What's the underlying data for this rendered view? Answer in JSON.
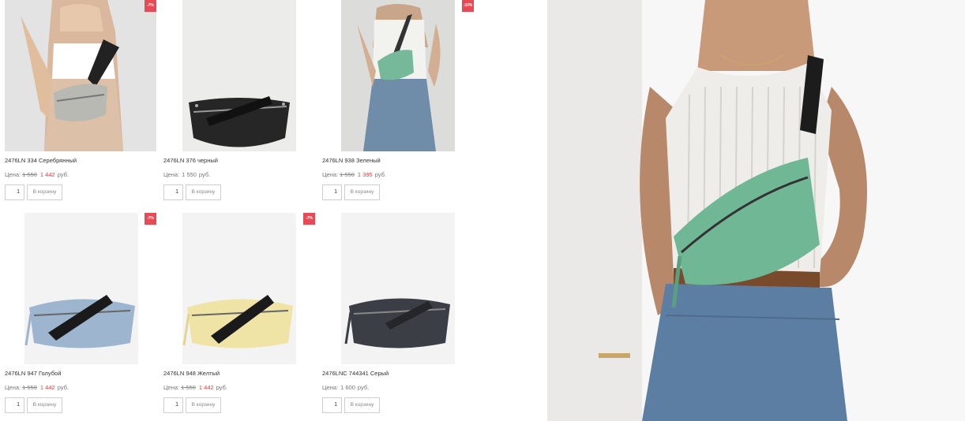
{
  "products": [
    {
      "name": "2476LN 334 Серебрянный",
      "price_label": "Цена:",
      "old_price": "1 550",
      "new_price": "1 442",
      "currency": "руб.",
      "badge": "-7%",
      "qty": "1",
      "cart_label": "В корзину"
    },
    {
      "name": "2476LN 376 черный",
      "price_label": "Цена:",
      "old_price": "",
      "new_price": "1 550",
      "currency": "руб.",
      "badge": "",
      "qty": "1",
      "cart_label": "В корзину"
    },
    {
      "name": "2476LN 938 Зеленый",
      "price_label": "Цена:",
      "old_price": "1 550",
      "new_price": "1 395",
      "currency": "руб.",
      "badge": "-10%",
      "qty": "1",
      "cart_label": "В корзину"
    },
    {
      "name": "2476LN 947 Голубой",
      "price_label": "Цена:",
      "old_price": "1 550",
      "new_price": "1 442",
      "currency": "руб.",
      "badge": "-7%",
      "qty": "1",
      "cart_label": "В корзину"
    },
    {
      "name": "2476LN 948 Желтый",
      "price_label": "Цена:",
      "old_price": "1 550",
      "new_price": "1 442",
      "currency": "руб.",
      "badge": "-7%",
      "qty": "1",
      "cart_label": "В корзину"
    },
    {
      "name": "2476LNC 744341 Серый",
      "price_label": "Цена:",
      "old_price": "",
      "new_price": "1 600",
      "currency": "руб.",
      "badge": "",
      "qty": "1",
      "cart_label": "В корзину"
    }
  ],
  "colors": {
    "sale_badge": "#e84a55",
    "sale_price": "#e8393f"
  }
}
